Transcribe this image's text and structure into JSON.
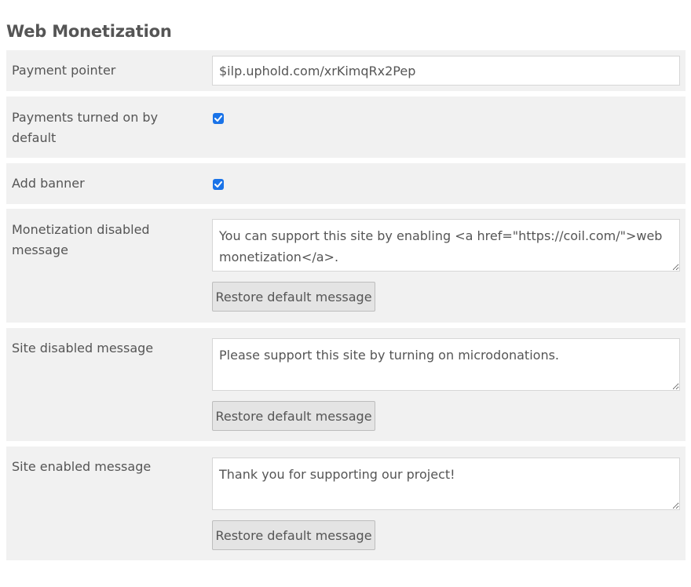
{
  "section": {
    "title": "Web Monetization"
  },
  "fields": {
    "payment_pointer": {
      "label": "Payment pointer",
      "value": "$ilp.uphold.com/xrKimqRx2Pep"
    },
    "payments_default": {
      "label": "Payments turned on by default",
      "checked": true
    },
    "add_banner": {
      "label": "Add banner",
      "checked": true
    },
    "monetization_disabled": {
      "label": "Monetization disabled message",
      "value": "You can support this site by enabling <a href=\"https://coil.com/\">web monetization</a>.",
      "button": "Restore default message"
    },
    "site_disabled": {
      "label": "Site disabled message",
      "value": "Please support this site by turning on microdonations.",
      "button": "Restore default message"
    },
    "site_enabled": {
      "label": "Site enabled message",
      "value": "Thank you for supporting our project!",
      "button": "Restore default message"
    }
  },
  "colors": {
    "row_background": "#f1f1f1",
    "checkbox_accent": "#1a73e8",
    "text": "#555555"
  }
}
